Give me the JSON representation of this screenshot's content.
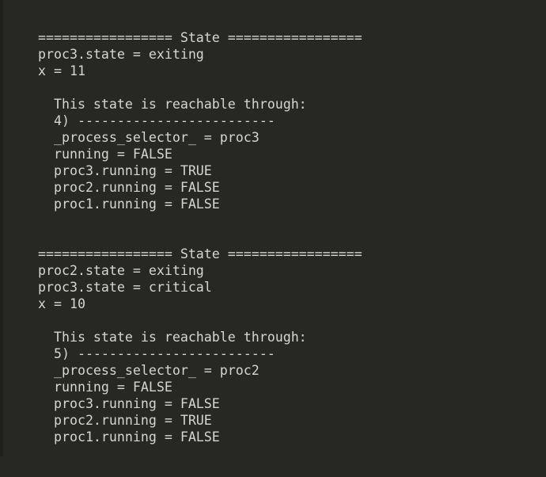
{
  "output": {
    "lines": [
      "================= State =================",
      "proc3.state = exiting",
      "x = 11",
      "",
      "  This state is reachable through:",
      "  4) -------------------------",
      "  _process_selector_ = proc3",
      "  running = FALSE",
      "  proc3.running = TRUE",
      "  proc2.running = FALSE",
      "  proc1.running = FALSE",
      "",
      "",
      "================= State =================",
      "proc2.state = exiting",
      "proc3.state = critical",
      "x = 10",
      "",
      "  This state is reachable through:",
      "  5) -------------------------",
      "  _process_selector_ = proc2",
      "  running = FALSE",
      "  proc3.running = FALSE",
      "  proc2.running = TRUE",
      "  proc1.running = FALSE"
    ]
  },
  "colors": {
    "background": "#272822",
    "text": "#d6d6cf"
  }
}
